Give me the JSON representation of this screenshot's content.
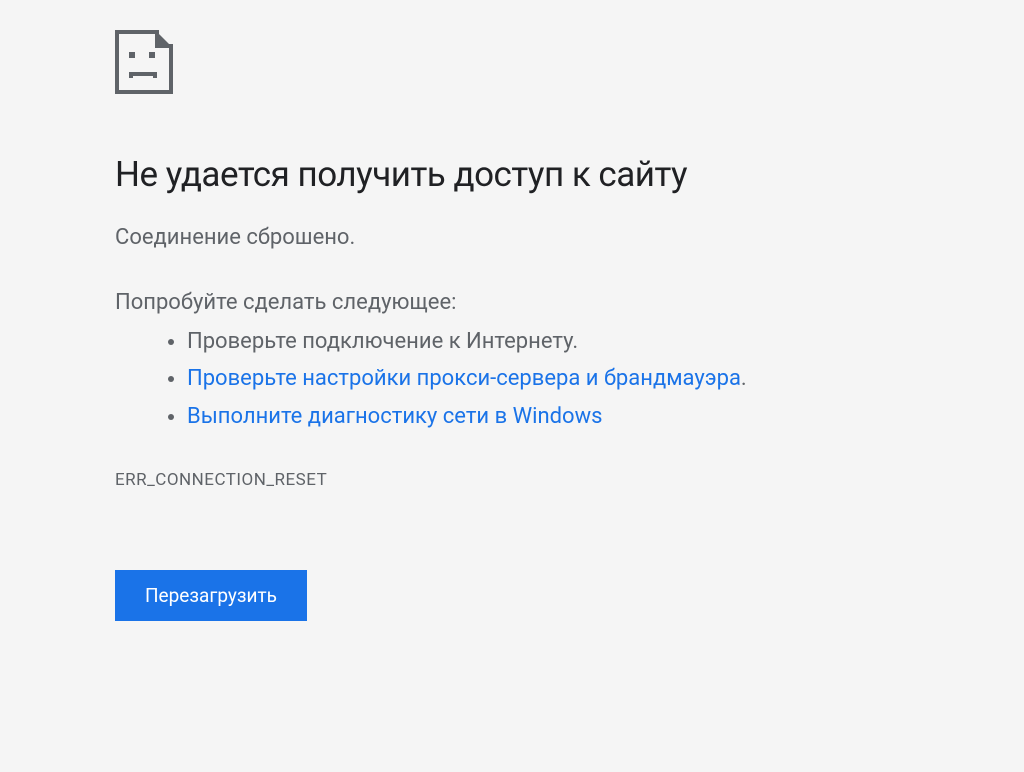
{
  "error": {
    "heading": "Не удается получить доступ к сайту",
    "sub_message": "Соединение сброшено.",
    "suggestions_intro": "Попробуйте сделать следующее:",
    "suggestions": {
      "item1": "Проверьте подключение к Интернету.",
      "item2_link": "Проверьте настройки прокси-сервера и брандмауэра",
      "item2_suffix": ".",
      "item3_link": "Выполните диагностику сети в Windows"
    },
    "error_code": "ERR_CONNECTION_RESET",
    "reload_button": "Перезагрузить"
  }
}
